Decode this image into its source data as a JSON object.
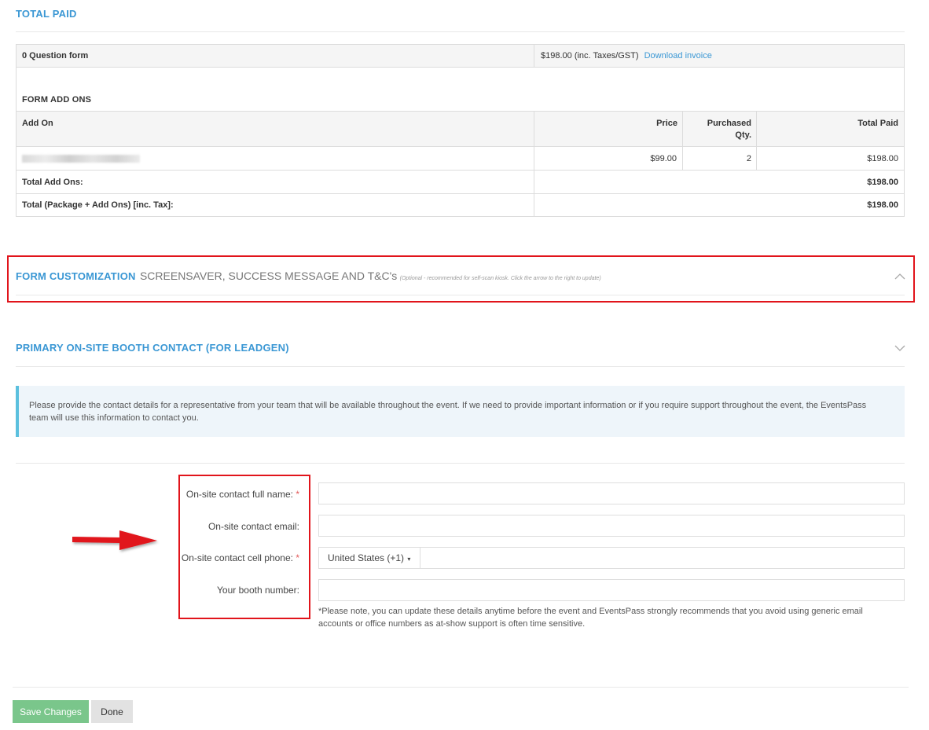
{
  "total_paid": {
    "heading": "TOTAL PAID",
    "form_name": "0 Question form",
    "amount": "$198.00 (inc. Taxes/GST)",
    "download_link": "Download invoice"
  },
  "addons": {
    "heading": "FORM ADD ONS",
    "columns": {
      "addon": "Add On",
      "price": "Price",
      "qty_line1": "Purchased",
      "qty_line2": "Qty.",
      "total": "Total Paid"
    },
    "row": {
      "price": "$99.00",
      "qty": "2",
      "total": "$198.00"
    },
    "total_addons_label": "Total Add Ons:",
    "total_addons_value": "$198.00",
    "grand_total_label": "Total (Package + Add Ons) [inc. Tax]:",
    "grand_total_value": "$198.00"
  },
  "form_customization": {
    "title_bold": "FORM CUSTOMIZATION",
    "title_rest": "SCREENSAVER, SUCCESS MESSAGE AND T&C's",
    "note": "(Optional - recommended for self-scan kiosk. Click the arrow to the right to update)"
  },
  "booth_contact": {
    "title": "PRIMARY ON-SITE BOOTH CONTACT (FOR LEADGEN)",
    "info": "Please provide the contact details for a representative from your team that will be available throughout the event. If we need to provide important information or if you require support throughout the event, the EventsPass team will use this information to contact you.",
    "fields": {
      "full_name_label": "On-site contact full name:",
      "email_label": "On-site contact email:",
      "phone_label": "On-site contact cell phone:",
      "booth_label": "Your booth number:",
      "required_mark": "*",
      "country_code": "United States (+1)"
    },
    "note": "*Please note, you can update these details anytime before the event and EventsPass strongly recommends that you avoid using generic email accounts or office numbers as at-show support is often time sensitive."
  },
  "buttons": {
    "save": "Save Changes",
    "done": "Done"
  },
  "colors": {
    "accent": "#3a97d4",
    "annotation_red": "#e1141b",
    "save_green": "#7ac68b"
  },
  "icons": {
    "chevron_up": "chevron-up-icon",
    "chevron_down": "chevron-down-icon",
    "arrow": "red-arrow-icon"
  }
}
